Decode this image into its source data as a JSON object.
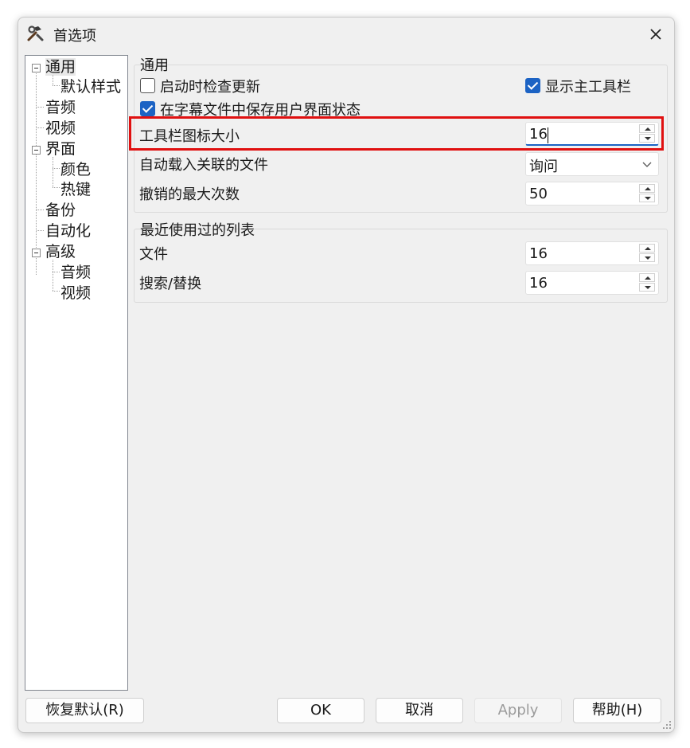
{
  "window": {
    "title": "首选项",
    "icon": "hammer-wrench-icon"
  },
  "tree": {
    "items": [
      {
        "label": "通用",
        "selected": true,
        "expandable": true
      },
      {
        "label": "默认样式"
      },
      {
        "label": "音频"
      },
      {
        "label": "视频"
      },
      {
        "label": "界面",
        "expandable": true
      },
      {
        "label": "颜色"
      },
      {
        "label": "热键"
      },
      {
        "label": "备份"
      },
      {
        "label": "自动化"
      },
      {
        "label": "高级",
        "expandable": true
      },
      {
        "label": "音频"
      },
      {
        "label": "视频"
      }
    ]
  },
  "general": {
    "title": "通用",
    "check_for_updates": {
      "label": "启动时检查更新",
      "checked": false
    },
    "show_main_toolbar": {
      "label": "显示主工具栏",
      "checked": true
    },
    "save_ui_state": {
      "label": "在字幕文件中保存用户界面状态",
      "checked": true
    },
    "toolbar_icon_size": {
      "label": "工具栏图标大小",
      "value": "16"
    },
    "auto_load_associated": {
      "label": "自动载入关联的文件",
      "value": "询问"
    },
    "max_undo": {
      "label": "撤销的最大次数",
      "value": "50"
    }
  },
  "recent": {
    "title": "最近使用过的列表",
    "files": {
      "label": "文件",
      "value": "16"
    },
    "search_replace": {
      "label": "搜索/替换",
      "value": "16"
    }
  },
  "buttons": {
    "restore_defaults": "恢复默认(R)",
    "ok": "OK",
    "cancel": "取消",
    "apply": "Apply",
    "help": "帮助(H)"
  },
  "colors": {
    "accent": "#1c63c4",
    "highlight_box": "#e01010"
  }
}
